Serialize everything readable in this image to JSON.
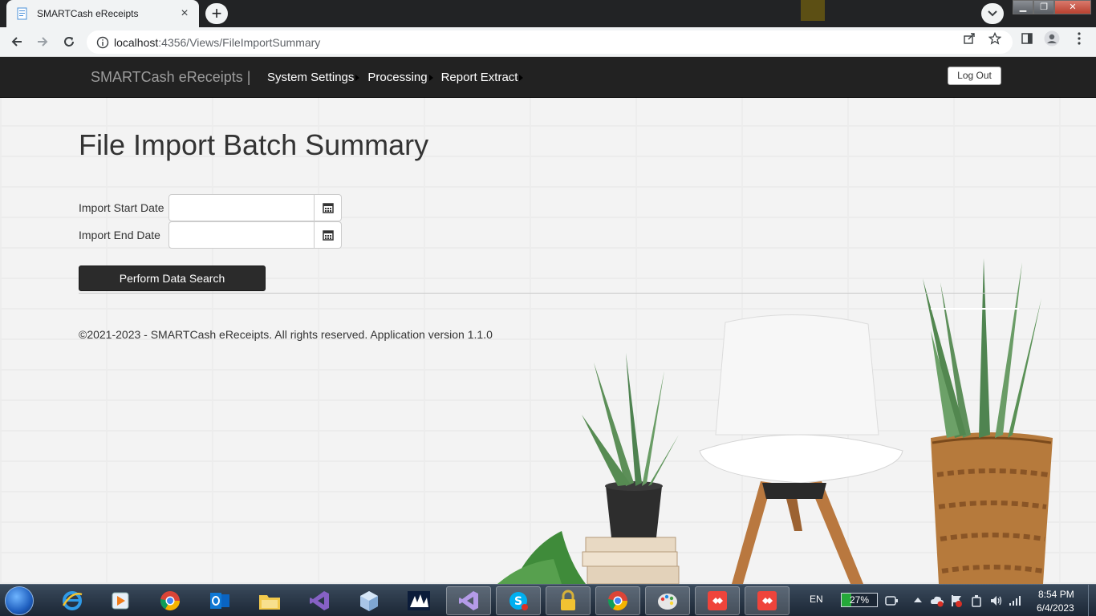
{
  "browser": {
    "tab_title": "SMARTCash eReceipts",
    "new_tab": "+",
    "url_host": "localhost",
    "url_rest": ":4356/Views/FileImportSummary"
  },
  "navbar": {
    "brand": "SMARTCash eReceipts |",
    "menu": [
      "System Settings",
      "Processing",
      "Report Extract"
    ],
    "logout": "Log Out"
  },
  "page": {
    "title": "File Import Batch Summary",
    "start_label": "Import Start Date",
    "start_value": "",
    "end_label": "Import End Date",
    "end_value": "",
    "search_button": "Perform Data Search",
    "footer": "©2021-2023 - SMARTCash eReceipts. All rights reserved. Application version 1.1.0"
  },
  "taskbar": {
    "apps": [
      "internet-explorer",
      "media-player",
      "chrome",
      "outlook",
      "file-explorer",
      "visual-studio",
      "virtualbox",
      "dynamics",
      "visual-studio-alt",
      "skype",
      "security-lock",
      "chrome-active",
      "paint",
      "anydesk",
      "anydesk-2"
    ],
    "language": "EN",
    "battery": "27%",
    "time": "8:54 PM",
    "date": "6/4/2023"
  }
}
